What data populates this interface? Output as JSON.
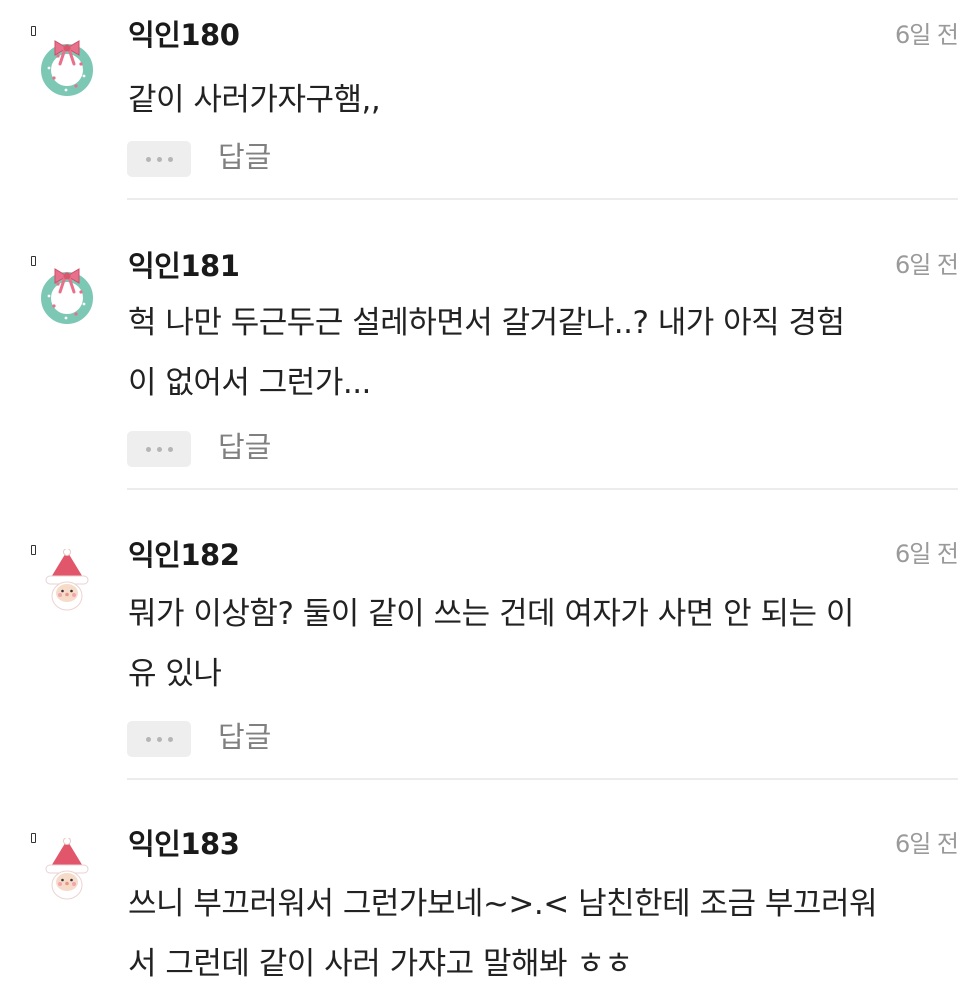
{
  "comments": [
    {
      "nickname": "익인180",
      "time": "6일 전",
      "avatar": "wreath-icon",
      "body": "같이 사러가자구햄,,",
      "more_label": "···",
      "reply_label": "답글"
    },
    {
      "nickname": "익인181",
      "time": "6일 전",
      "avatar": "wreath-icon",
      "body": "헉 나만 두근두근 설레하면서 갈거같나..? 내가 아직 경험\n이 없어서 그런가...",
      "more_label": "···",
      "reply_label": "답글"
    },
    {
      "nickname": "익인182",
      "time": "6일 전",
      "avatar": "santa-icon",
      "body": "뭐가 이상함? 둘이 같이 쓰는 건데 여자가 사면 안 되는 이\n유 있나",
      "more_label": "···",
      "reply_label": "답글"
    },
    {
      "nickname": "익인183",
      "time": "6일 전",
      "avatar": "santa-icon",
      "body": "쓰니 부끄러워서 그런가보네~>.< 남친한테 조금 부끄러워\n서 그런데 같이 사러 가쟈고 말해봐 ㅎㅎ"
    }
  ],
  "colors": {
    "wreath_green": "#7cc8b4",
    "bow_pink": "#e8708a",
    "santa_red": "#e2566b",
    "face": "#f6dcc8"
  }
}
